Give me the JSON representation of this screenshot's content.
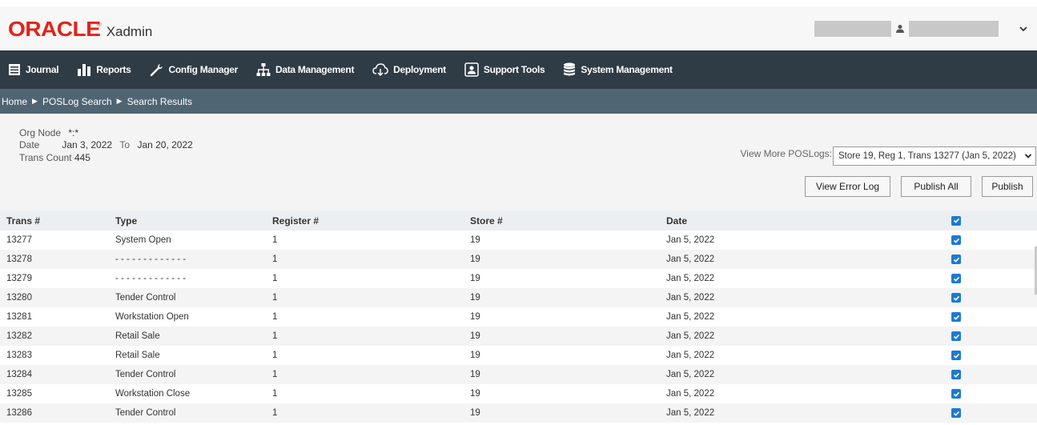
{
  "header": {
    "logo_brand": "ORACLE",
    "logo_app": "Xadmin",
    "user_icon": "user-icon",
    "menu_icon": "chevron-down-icon"
  },
  "nav": {
    "items": [
      {
        "label": "Journal",
        "icon": "journal-icon"
      },
      {
        "label": "Reports",
        "icon": "bar-chart-icon"
      },
      {
        "label": "Config Manager",
        "icon": "wrench-icon"
      },
      {
        "label": "Data Management",
        "icon": "hierarchy-icon"
      },
      {
        "label": "Deployment",
        "icon": "cloud-download-icon"
      },
      {
        "label": "Support Tools",
        "icon": "support-icon"
      },
      {
        "label": "System Management",
        "icon": "database-icon"
      }
    ]
  },
  "breadcrumb": {
    "items": [
      "Home",
      "POSLog Search",
      "Search Results"
    ]
  },
  "summary": {
    "org_node_label": "Org Node",
    "org_node_value": "*:*",
    "date_label": "Date",
    "date_from": "Jan 3, 2022",
    "date_to_label": "To",
    "date_to": "Jan 20, 2022",
    "trans_count_label": "Trans Count",
    "trans_count_value": "445",
    "view_more_label": "View More POSLogs:",
    "view_more_selected": "Store 19, Reg 1, Trans 13277 (Jan 5, 2022)"
  },
  "buttons": {
    "view_error_log": "View Error Log",
    "publish_all": "Publish All",
    "publish": "Publish"
  },
  "table": {
    "columns": [
      "Trans #",
      "Type",
      "Register #",
      "Store #",
      "Date"
    ],
    "rows": [
      {
        "trans": "13277",
        "type": "System Open",
        "register": "1",
        "store": "19",
        "date": "Jan 5, 2022",
        "checked": true
      },
      {
        "trans": "13278",
        "type": "- - - - - - - - - - - - -",
        "register": "1",
        "store": "19",
        "date": "Jan 5, 2022",
        "checked": true
      },
      {
        "trans": "13279",
        "type": "- - - - - - - - - - - - -",
        "register": "1",
        "store": "19",
        "date": "Jan 5, 2022",
        "checked": true
      },
      {
        "trans": "13280",
        "type": "Tender Control",
        "register": "1",
        "store": "19",
        "date": "Jan 5, 2022",
        "checked": true
      },
      {
        "trans": "13281",
        "type": "Workstation Open",
        "register": "1",
        "store": "19",
        "date": "Jan 5, 2022",
        "checked": true
      },
      {
        "trans": "13282",
        "type": "Retail Sale",
        "register": "1",
        "store": "19",
        "date": "Jan 5, 2022",
        "checked": true
      },
      {
        "trans": "13283",
        "type": "Retail Sale",
        "register": "1",
        "store": "19",
        "date": "Jan 5, 2022",
        "checked": true
      },
      {
        "trans": "13284",
        "type": "Tender Control",
        "register": "1",
        "store": "19",
        "date": "Jan 5, 2022",
        "checked": true
      },
      {
        "trans": "13285",
        "type": "Workstation Close",
        "register": "1",
        "store": "19",
        "date": "Jan 5, 2022",
        "checked": true
      },
      {
        "trans": "13286",
        "type": "Tender Control",
        "register": "1",
        "store": "19",
        "date": "Jan 5, 2022",
        "checked": true
      }
    ]
  },
  "colors": {
    "brand_red": "#e2231a",
    "nav_bg": "#2f3b45",
    "breadcrumb_bg": "#4f6574",
    "checkbox_blue": "#1d7ad1"
  }
}
